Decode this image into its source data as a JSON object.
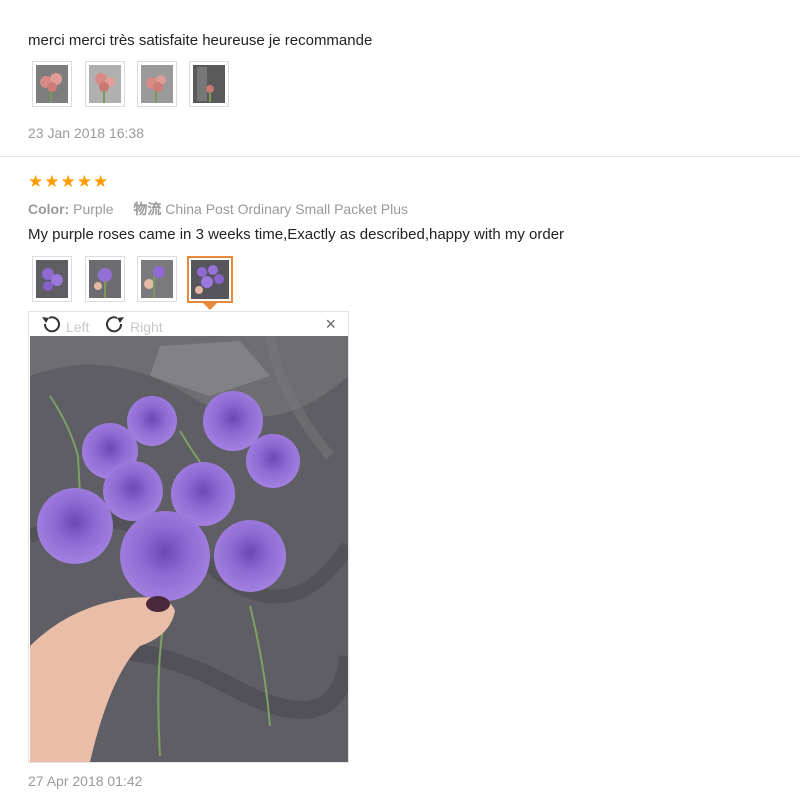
{
  "review1": {
    "text": "merci merci très satisfaite heureuse je recommande",
    "date": "23 Jan 2018 16:38",
    "thumbnails": [
      "pink-rose-photo-1",
      "pink-rose-photo-2",
      "pink-rose-photo-3",
      "pink-rose-photo-4"
    ]
  },
  "review2": {
    "rating": 5,
    "color_label": "Color:",
    "color_value": "Purple",
    "shipping_icon_text": "物流",
    "shipping_value": "China Post Ordinary Small Packet Plus",
    "text": "My purple roses came in 3 weeks time,Exactly as described,happy with my order",
    "date": "27 Apr 2018 01:42",
    "thumbnails": [
      "purple-rose-photo-1",
      "purple-rose-photo-2",
      "purple-rose-photo-3",
      "purple-rose-photo-4"
    ],
    "active_thumbnail_index": 3
  },
  "viewer": {
    "rotate_left_label": "Left",
    "rotate_right_label": "Right",
    "close_label": "×"
  },
  "colors": {
    "star": "#ff9a00",
    "accent": "#e8883b",
    "rose": "#8f6ad3",
    "fabric": "#5e5e64"
  },
  "icons": [
    "rotate-left-icon",
    "rotate-right-icon",
    "close-icon",
    "star-icon"
  ]
}
